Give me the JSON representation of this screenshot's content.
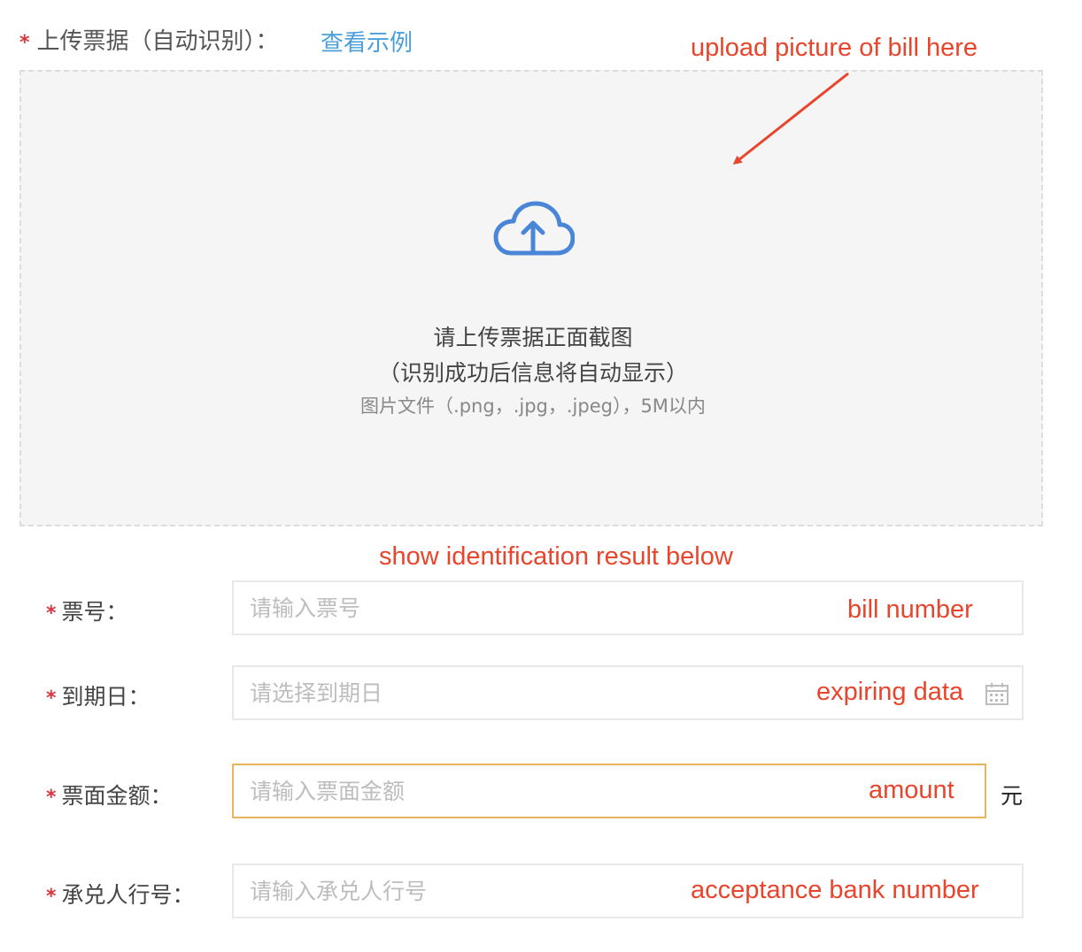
{
  "upload": {
    "required_mark": "*",
    "label": "上传票据（自动识别）：",
    "example_link": "查看示例",
    "prompt_line1": "请上传票据正面截图",
    "prompt_line2": "（识别成功后信息将自动显示）",
    "hint": "图片文件（.png，.jpg，.jpeg），5M以内",
    "icon": "cloud-upload-icon"
  },
  "annotations": {
    "upload_note": "upload picture of bill here",
    "result_note": "show identification result below",
    "bill_number": "bill number",
    "expiring": "expiring data",
    "amount": "amount",
    "acceptance": "acceptance bank number"
  },
  "form": {
    "bill_no": {
      "required_mark": "*",
      "label": "票号：",
      "placeholder": "请输入票号",
      "value": ""
    },
    "due_date": {
      "required_mark": "*",
      "label": "到期日：",
      "placeholder": "请选择到期日",
      "value": "",
      "icon": "calendar-icon"
    },
    "amount": {
      "required_mark": "*",
      "label": "票面金额：",
      "placeholder": "请输入票面金额",
      "value": "",
      "unit": "元"
    },
    "acceptor_bank": {
      "required_mark": "*",
      "label": "承兑人行号：",
      "placeholder": "请输入承兑人行号",
      "value": ""
    }
  },
  "colors": {
    "annotation": "#e8452c",
    "link": "#4a9fd8",
    "required": "#d9363e",
    "focused_border": "#e7b55b",
    "upload_icon": "#4a86d8"
  }
}
